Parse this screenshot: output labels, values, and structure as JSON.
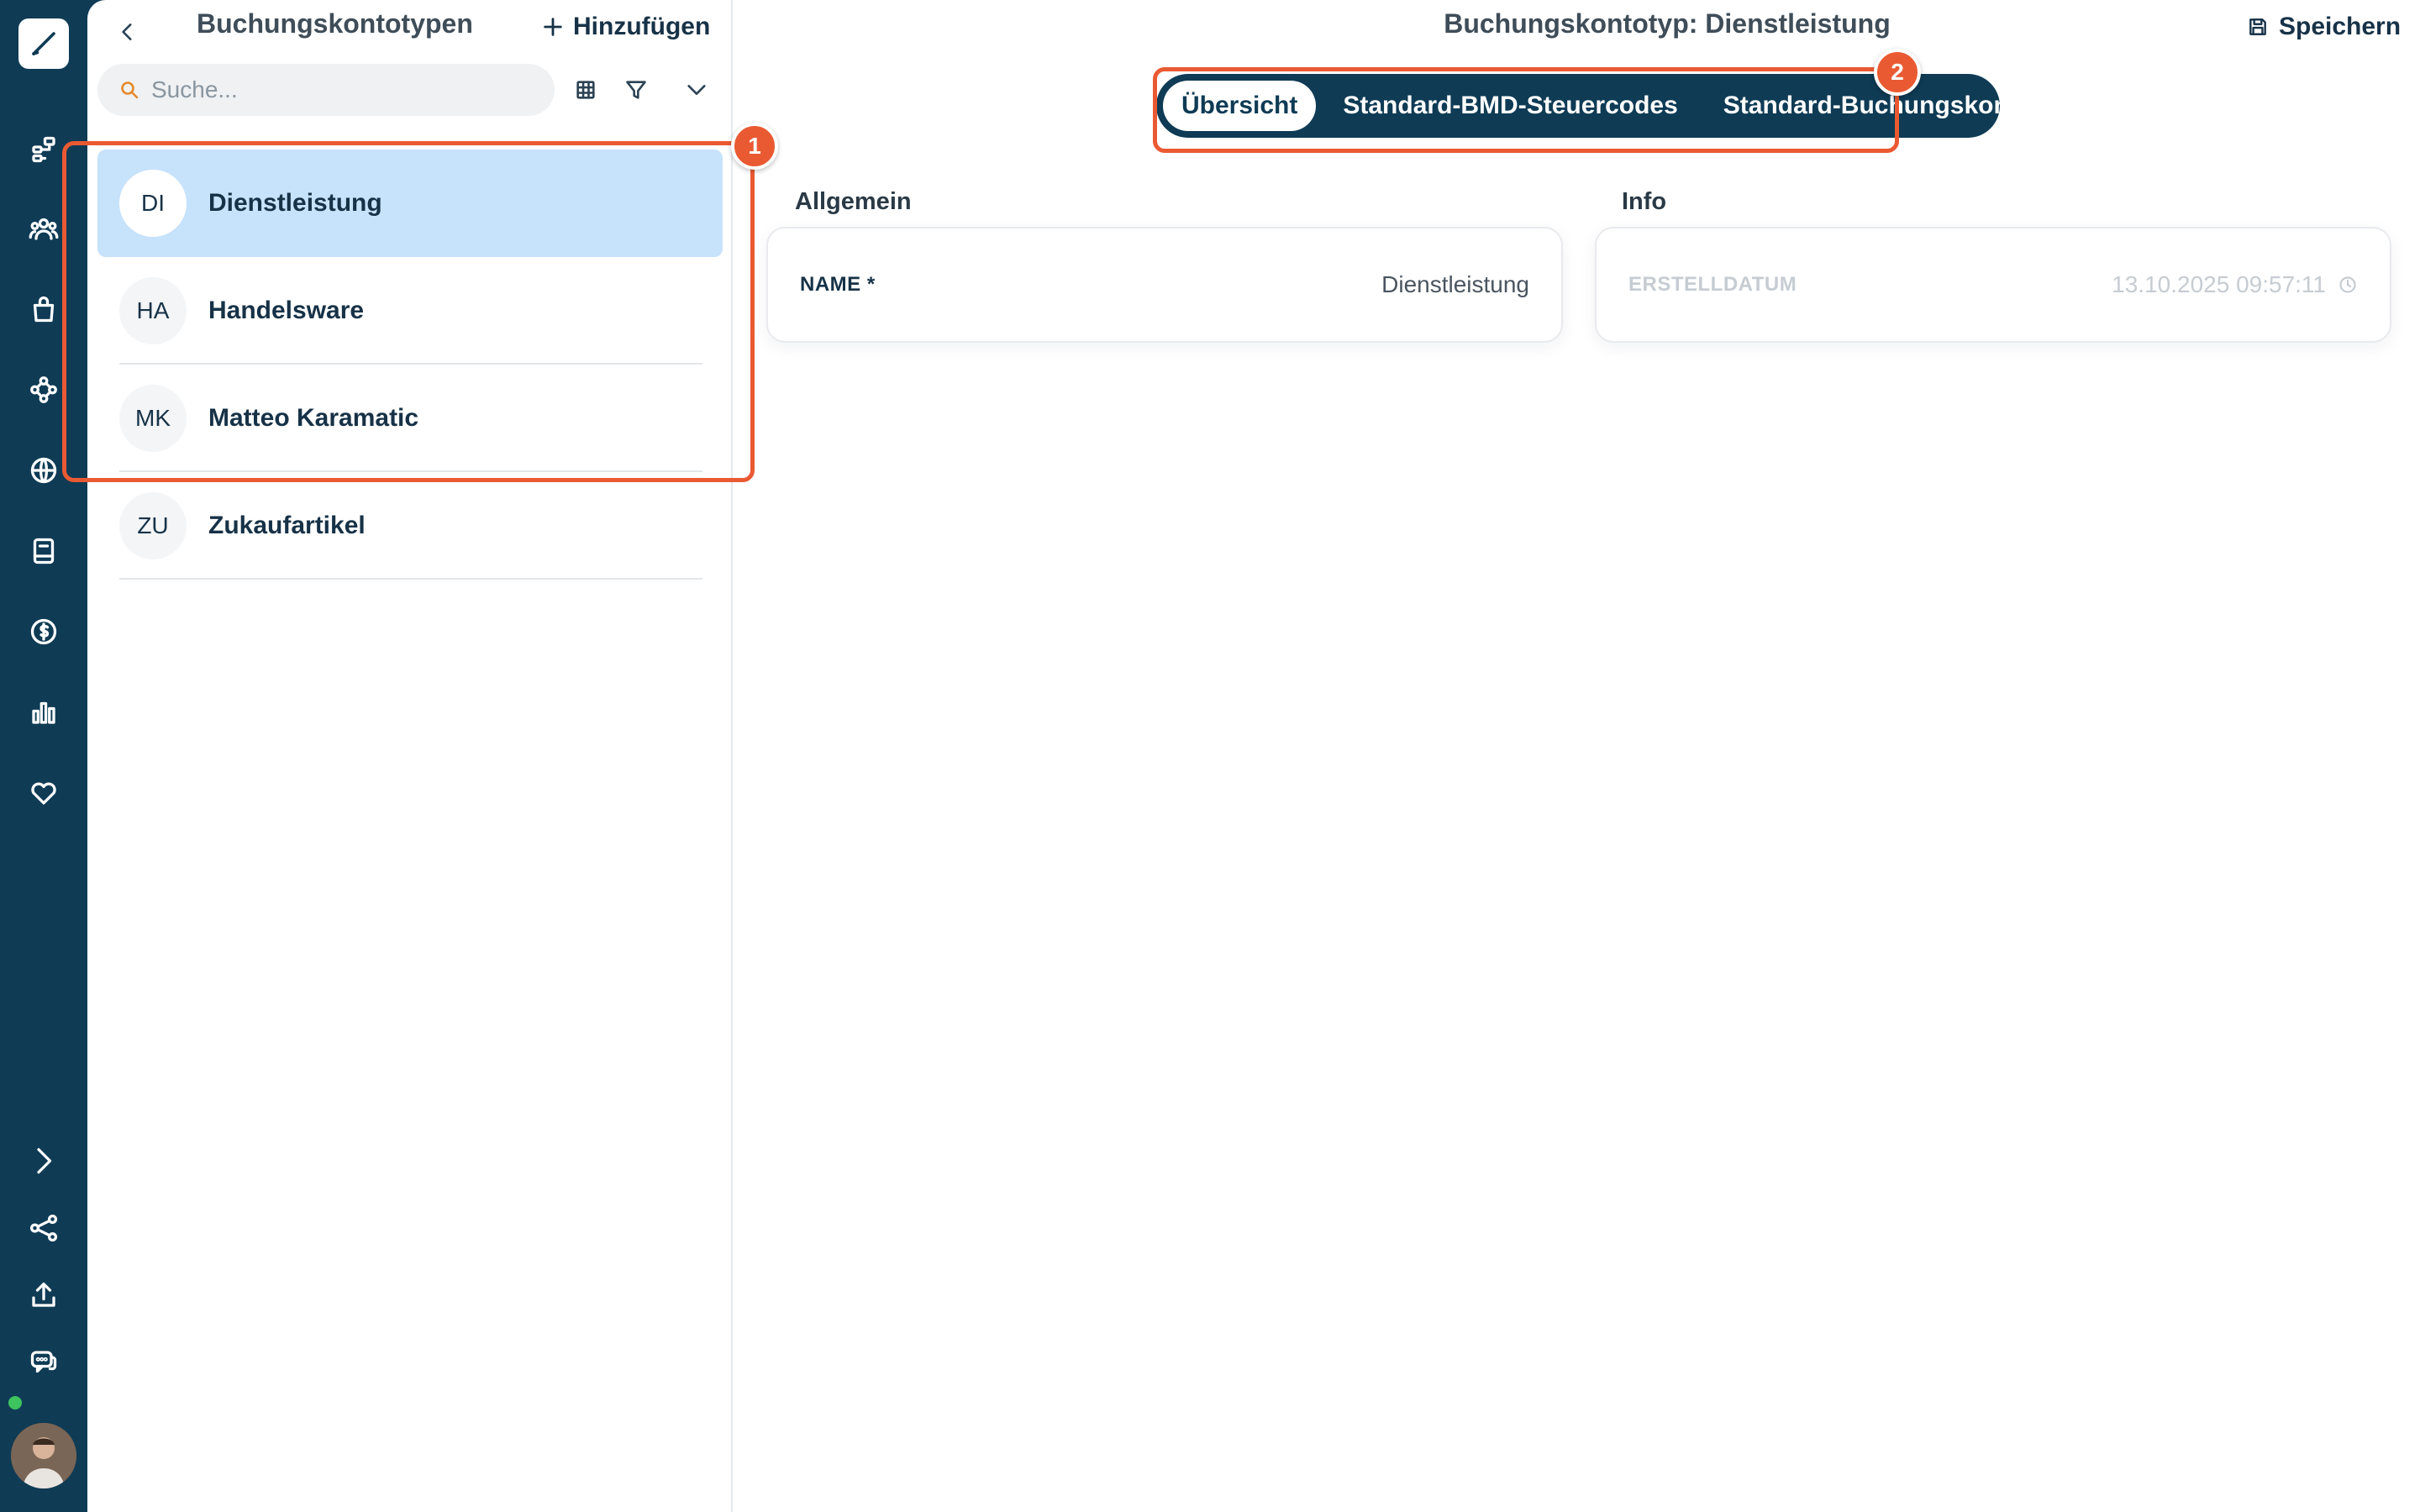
{
  "app": {
    "rail_icons": [
      "logo-pen-icon",
      "hierarchy-icon",
      "users-icon",
      "shopping-bag-icon",
      "network-icon",
      "globe-icon",
      "book-icon",
      "dollar-icon",
      "bar-chart-icon",
      "heart-icon",
      "chevron-right-icon",
      "share-icon",
      "upload-icon",
      "chat-icon"
    ]
  },
  "list_pane": {
    "title": "Buchungskontotypen",
    "add_label": "Hinzufügen",
    "search_placeholder": "Suche...",
    "items": [
      {
        "initials": "DI",
        "label": "Dienstleistung",
        "selected": true
      },
      {
        "initials": "HA",
        "label": "Handelsware",
        "selected": false
      },
      {
        "initials": "MK",
        "label": "Matteo Karamatic",
        "selected": false
      },
      {
        "initials": "ZU",
        "label": "Zukaufartikel",
        "selected": false
      }
    ]
  },
  "detail": {
    "title": "Buchungskontotyp: Dienstleistung",
    "save_label": "Speichern",
    "tabs": [
      {
        "label": "Übersicht",
        "active": true
      },
      {
        "label": "Standard-BMD-Steuercodes",
        "active": false
      },
      {
        "label": "Standard-Buchungskonten",
        "active": false
      }
    ],
    "general": {
      "section": "Allgemein",
      "name_label": "NAME *",
      "name_value": "Dienstleistung"
    },
    "info": {
      "section": "Info",
      "created_label": "ERSTELLDATUM",
      "created_value": "13.10.2025 09:57:11"
    }
  },
  "annotations": {
    "marker_1": "1",
    "marker_2": "2",
    "color": "#ea5a32"
  },
  "colors": {
    "rail": "#0f3b55",
    "selected_row": "#c7e2fb",
    "text_primary": "#173247",
    "search_icon": "#e5892a",
    "status_online": "#3ec35f"
  }
}
